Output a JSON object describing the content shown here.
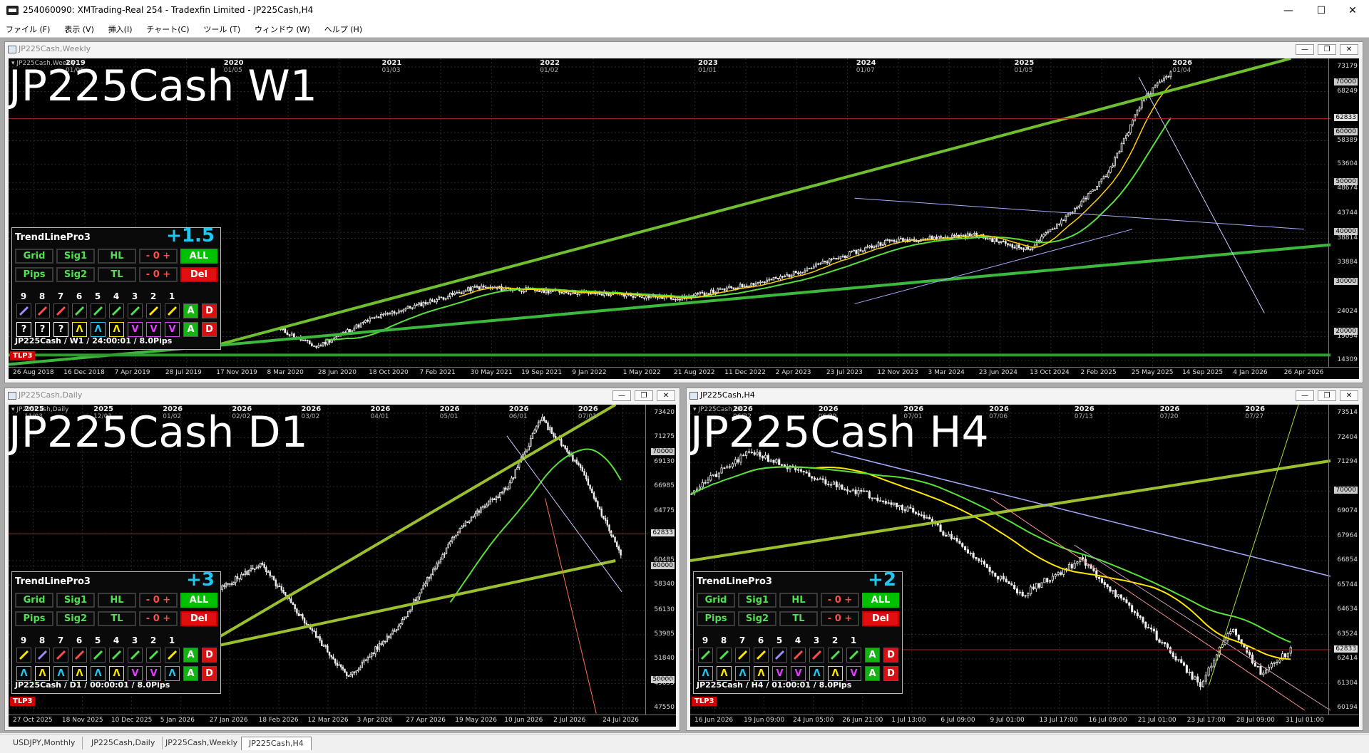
{
  "window": {
    "title": "254060090: XMTrading-Real 254 - Tradexfin Limited - JP225Cash,H4",
    "minimize": "—",
    "maximize": "☐",
    "close": "✕"
  },
  "menu": [
    "ファイル (F)",
    "表示 (V)",
    "挿入(I)",
    "チャート(C)",
    "ツール (T)",
    "ウィンドウ (W)",
    "ヘルプ (H)"
  ],
  "charts": {
    "weekly": {
      "window_title": "JP225Cash,Weekly",
      "big_title": "JP225Cash W1",
      "symbol_header": "JP225Cash,Weekly",
      "top_labels": [
        {
          "year": "2019",
          "date": "01/06"
        },
        {
          "year": "2020",
          "date": "01/05"
        },
        {
          "year": "2021",
          "date": "01/03"
        },
        {
          "year": "2022",
          "date": "01/02"
        },
        {
          "year": "2023",
          "date": "01/01"
        },
        {
          "year": "2024",
          "date": "01/07"
        },
        {
          "year": "2025",
          "date": "01/05"
        },
        {
          "year": "2026",
          "date": "01/04"
        }
      ],
      "y_labels": [
        "73179",
        "70000",
        "68249",
        "62833",
        "60000",
        "58389",
        "53604",
        "50000",
        "48674",
        "43744",
        "40000",
        "38814",
        "33884",
        "30000",
        "24024",
        "20000",
        "19094",
        "14309"
      ],
      "current_price": "62833",
      "x_labels": [
        "26 Aug 2018",
        "16 Dec 2018",
        "7 Apr 2019",
        "28 Jul 2019",
        "17 Nov 2019",
        "8 Mar 2020",
        "28 Jun 2020",
        "18 Oct 2020",
        "7 Feb 2021",
        "30 May 2021",
        "19 Sep 2021",
        "9 Jan 2022",
        "1 May 2022",
        "21 Aug 2022",
        "11 Dec 2022",
        "2 Apr 2023",
        "23 Jul 2023",
        "12 Nov 2023",
        "3 Mar 2024",
        "23 Jun 2024",
        "13 Oct 2024",
        "2 Feb 2025",
        "25 May 2025",
        "14 Sep 2025",
        "4 Jan 2026",
        "26 Apr 2026"
      ],
      "panel": {
        "title": "TrendLinePro3",
        "score": "+1.5",
        "row1": [
          "Grid",
          "Sig1",
          "HL",
          "- 0 +",
          "ALL"
        ],
        "row2": [
          "Pips",
          "Sig2",
          "TL",
          "- 0 +",
          "Del"
        ],
        "numbers": [
          "9",
          "8",
          "7",
          "6",
          "5",
          "4",
          "3",
          "2",
          "1"
        ],
        "signals": [
          "?",
          "?",
          "?",
          "Λ",
          "Λ",
          "Λ",
          "V",
          "V",
          "V"
        ],
        "footer": "JP225Cash / W1 / 24:00:01 / 8.0Pips"
      },
      "badge": "TLP3"
    },
    "daily": {
      "window_title": "JP225Cash,Daily",
      "big_title": "JP225Cash D1",
      "symbol_header": "JP225Cash,Daily",
      "top_labels": [
        {
          "year": "2025",
          "date": "11/03"
        },
        {
          "year": "2025",
          "date": "12/01"
        },
        {
          "year": "2026",
          "date": "01/02"
        },
        {
          "year": "2026",
          "date": "02/02"
        },
        {
          "year": "2026",
          "date": "03/02"
        },
        {
          "year": "2026",
          "date": "04/01"
        },
        {
          "year": "2026",
          "date": "05/01"
        },
        {
          "year": "2026",
          "date": "06/01"
        },
        {
          "year": "2026",
          "date": "07/01"
        }
      ],
      "y_labels": [
        "73420",
        "71275",
        "70000",
        "69130",
        "66985",
        "64775",
        "62833",
        "60485",
        "60000",
        "58340",
        "56130",
        "53985",
        "51840",
        "50000",
        "49695",
        "47550"
      ],
      "current_price": "62833",
      "x_labels": [
        "27 Oct 2025",
        "18 Nov 2025",
        "10 Dec 2025",
        "5 Jan 2026",
        "27 Jan 2026",
        "18 Feb 2026",
        "12 Mar 2026",
        "3 Apr 2026",
        "27 Apr 2026",
        "19 May 2026",
        "10 Jun 2026",
        "2 Jul 2026",
        "24 Jul 2026"
      ],
      "panel": {
        "title": "TrendLinePro3",
        "score": "+3",
        "row1": [
          "Grid",
          "Sig1",
          "HL",
          "- 0 +",
          "ALL"
        ],
        "row2": [
          "Pips",
          "Sig2",
          "TL",
          "- 0 +",
          "Del"
        ],
        "numbers": [
          "9",
          "8",
          "7",
          "6",
          "5",
          "4",
          "3",
          "2",
          "1"
        ],
        "signals": [
          "Λ",
          "Λ",
          "Λ",
          "Λ",
          "Λ",
          "Λ",
          "V",
          "V",
          "Λ"
        ],
        "footer": "JP225Cash / D1 / 00:00:01 / 8.0Pips"
      },
      "badge": "TLP3"
    },
    "h4": {
      "window_title": "JP225Cash,H4",
      "big_title": "JP225Cash H4",
      "symbol_header": "JP225Cash,H4",
      "top_labels": [
        {
          "year": "2026",
          "date": "06/22"
        },
        {
          "year": "2026",
          "date": "06/29"
        },
        {
          "year": "2026",
          "date": "07/01"
        },
        {
          "year": "2026",
          "date": "07/06"
        },
        {
          "year": "2026",
          "date": "07/13"
        },
        {
          "year": "2026",
          "date": "07/20"
        },
        {
          "year": "2026",
          "date": "07/27"
        }
      ],
      "y_labels": [
        "73514",
        "72404",
        "71294",
        "70000",
        "69074",
        "67964",
        "66854",
        "65744",
        "64634",
        "63524",
        "62833",
        "62414",
        "61304",
        "60194"
      ],
      "current_price": "62833",
      "x_labels": [
        "16 Jun 2026",
        "19 Jun 09:00",
        "24 Jun 05:00",
        "26 Jun 21:00",
        "1 Jul 13:00",
        "6 Jul 09:00",
        "9 Jul 01:00",
        "13 Jul 17:00",
        "16 Jul 09:00",
        "21 Jul 01:00",
        "23 Jul 17:00",
        "28 Jul 09:00",
        "31 Jul 01:00"
      ],
      "panel": {
        "title": "TrendLinePro3",
        "score": "+2",
        "row1": [
          "Grid",
          "Sig1",
          "HL",
          "- 0 +",
          "ALL"
        ],
        "row2": [
          "Pips",
          "Sig2",
          "TL",
          "- 0 +",
          "Del"
        ],
        "numbers": [
          "9",
          "8",
          "7",
          "6",
          "5",
          "4",
          "3",
          "2",
          "1"
        ],
        "signals": [
          "Λ",
          "Λ",
          "Λ",
          "Λ",
          "V",
          "V",
          "Λ",
          "Λ",
          "V"
        ],
        "footer": "JP225Cash / H4 / 01:00:01 / 8.0Pips"
      },
      "badge": "TLP3"
    }
  },
  "tabs": [
    "USDJPY,Monthly",
    "JP225Cash,Daily",
    "JP225Cash,Weekly",
    "JP225Cash,H4"
  ],
  "active_tab": "JP225Cash,H4",
  "colors": {
    "bull_signal": "#ffe600",
    "cyan_signal": "#1ec8f0",
    "bear_signal": "#e040fb",
    "accent_green": "#4fe24f",
    "del_red": "#e01010"
  }
}
